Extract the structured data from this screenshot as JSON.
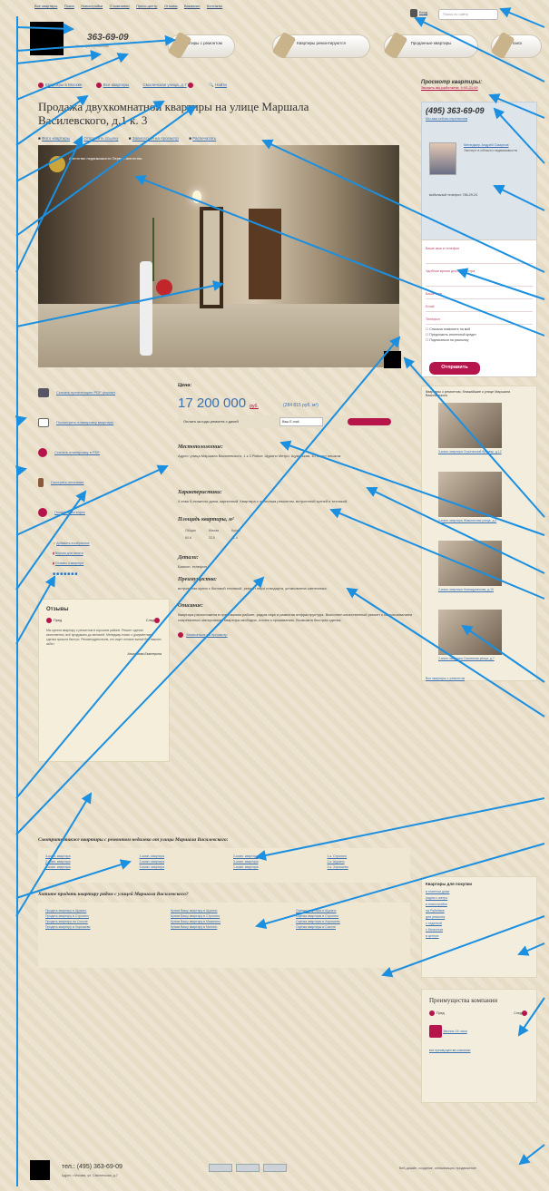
{
  "topnav": {
    "items": [
      "Все квартиры",
      "Поиск",
      "Новостройки",
      "О компании",
      "Пресс-центр",
      "Отзывы",
      "Вакансии",
      "Контакты"
    ]
  },
  "header": {
    "phone": "363-69-09",
    "tagline": "Квартиры с ремонтом",
    "search_placeholder": "Поиск по сайту",
    "login": "Вход"
  },
  "nav": [
    {
      "label": "Квартиры с ремонтом"
    },
    {
      "label": "Квартиры ремонтируются"
    },
    {
      "label": "Проданные квартиры"
    },
    {
      "label": "Поиск"
    }
  ],
  "crumbs": [
    "Квартиры в Москве",
    "Все квартиры",
    "Смоленская улица, д.7"
  ],
  "crumbs_search": "Найти",
  "title": "Продажа двухкомнатной квартиры на улице Маршала Василевского, д.1 к. 3",
  "meta": [
    "Фото квартиры",
    "Отправить ссылку",
    "Записаться на просмотр",
    "Распечатать"
  ],
  "photo": {
    "watermark": "Агентство недвижимости Первое агентство"
  },
  "actions": [
    "Скачать презентацию PDF формат",
    "Посмотреть планировку квартиры",
    "Скачать планировку в PDF",
    "Смотреть описание",
    "Показать на карте"
  ],
  "links": [
    "Добавить в избранное",
    "Версия для печати",
    "Отзывы о квартире"
  ],
  "review": {
    "title": "Отзывы",
    "prev": "Пред",
    "next": "След",
    "text": "Мы купили квартиру с ремонтом в хорошем районе. Ремонт сделан качественно, всё продумано до мелочей. Менеджер помог с документами, сделка прошла быстро. Рекомендуем всем, кто ищет готовое жильё без лишних забот.",
    "author": "Анисимова Екатерина"
  },
  "price": {
    "heading": "Цена:",
    "value": "17 200 000",
    "currency": "руб.",
    "per_m2": "(284 815 руб. м²)",
    "calc_label": "Оплата за годы ремонта с дачей",
    "calc_placeholder": "Ваш E-mail"
  },
  "location": {
    "heading": "Местоположение:",
    "text": "Адрес: улица Маршала Василевского, 1 к.3 Район: Щукино Метро: Щукинская, 10 минут пешком"
  },
  "features": {
    "heading": "Характеристики:",
    "text": "4 этаж 9-этажного дома, кирпичный. Квартира с отличным ремонтом, встроенной кухней и техникой."
  },
  "area": {
    "heading": "Площадь квартиры, м²",
    "cols": [
      "Общая",
      "Жилая",
      "Кухня"
    ],
    "vals": [
      "60.6",
      "33.5",
      "11.4"
    ]
  },
  "extras": {
    "heading": "Детали:",
    "text": "Балкон, телефон"
  },
  "advantages": {
    "heading": "Преимущества:",
    "text": "встроенная кухня с бытовой техникой, ремонт евро стандарта, установлена сантехника"
  },
  "description": {
    "heading": "Описание:",
    "text": "Квартира расположена в престижном районе, рядом парк и развитая инфраструктура. Выполнен качественный ремонт с использованием современных материалов. Квартира свободна, готова к проживанию. Возможна быстрая сделка.",
    "link": "Записаться на просмотр"
  },
  "sidebar": {
    "heading": "Просмотр квартиры:",
    "note": "Звонить вы работаете: 9:00-21:00",
    "phone": "(495) 363-69-09",
    "callback": "Мы вам сейчас перезвоним",
    "manager": "Менеджер Андрей Смирнов",
    "manager_role": "Эксперт в области недвижимости",
    "manager_phone": "мобильный телефон: 786-29-24",
    "form_fields": [
      "Ваше имя и телефон",
      "Удобное время для просмотра",
      "Ваше имя",
      "Email",
      "Телефон"
    ],
    "checkboxes": [
      "Сначала позвоните на мой",
      "Предложить ипотечный кредит",
      "Подписаться на рассылку"
    ],
    "send": "Отправить",
    "ads_heading": "Квартиры с ремонтом, ближайшие к улице Маршала Василевского",
    "ads": [
      "3-комн. квартира Строгинский бульвар, д.12",
      "2-комн. квартира Живописная улица, д.4",
      "2-комн. квартира Новощукинская, д.10",
      "2-комн. квартира Соколиная улица, д.7",
      "2-комн. квартира Рогачевский переулок, д.1"
    ],
    "ads_more": "Все квартиры с ремонтом",
    "kv_heading": "Квартиры для покупки",
    "kv_items": [
      "в элитном доме",
      "рядом с метро",
      "в новостройке",
      "на Рублёвке",
      "для ремонта",
      "с отделкой",
      "с балконом",
      "в центре"
    ],
    "adv_heading": "Преимущества компании",
    "adv_prev": "Пред",
    "adv_next": "След",
    "adv_link": "Звонок 24 часа",
    "adv_all": "все преимущества компании"
  },
  "also": {
    "heading": "Смотрите также квартиры с ремонтом недалеко от улицы Маршала Василевского:",
    "cols": [
      [
        "3-комн. квартира",
        "2-комн. квартира",
        "1-комн. квартира"
      ],
      [
        "1-комн. квартира",
        "2-комн. квартира",
        "3-комн. квартира"
      ],
      [
        "2-комн. квартира",
        "3-комн. квартира",
        "1-комн. квартира"
      ],
      [
        "1-к. Строгино",
        "2-к. Щукино",
        "3-к. Хорошево"
      ]
    ]
  },
  "sell": {
    "heading": "Хотите продать квартиру рядом с улицей Маршала Василевского?",
    "cols": [
      [
        "Продать квартиру в Щукино",
        "Продать квартиру в Строгино",
        "Продать квартиру на Соколе",
        "Продать квартиру в Хорошево"
      ],
      [
        "Купим Вашу квартиру в Щукино",
        "Купим Вашу квартиру в Строгино",
        "Купим Вашу квартиру в Мякинино",
        "Купим Вашу квартиру в Митино"
      ],
      [
        "Оценка квартиры в Щукино",
        "Оценка квартиры в Строгино",
        "Оценка квартиры в Хорошево",
        "Оценка квартиры в Соколе"
      ]
    ]
  },
  "footer": {
    "phone": "тел.: (495) 363-69-09",
    "address": "Адрес: г.Москва, ул. Смоленская, д.7",
    "design": "Веб-дизайн, создание, оптимизация, продвижение"
  }
}
